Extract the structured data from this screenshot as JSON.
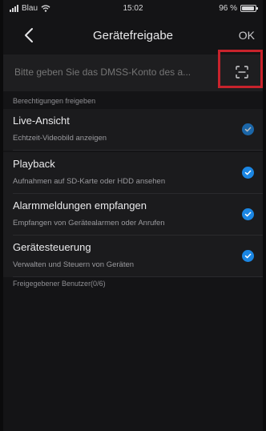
{
  "status_bar": {
    "carrier": "Blau",
    "time": "15:02",
    "battery": "96 %",
    "battery_level": 0.96
  },
  "nav": {
    "title": "Gerätefreigabe",
    "ok_label": "OK"
  },
  "account": {
    "placeholder": "Bitte geben Sie das DMSS-Konto des a..."
  },
  "sections": {
    "permissions": "Berechtigungen freigeben",
    "shared_users": "Freigegebener Benutzer(0/6)"
  },
  "permissions": [
    {
      "label": "Live-Ansicht",
      "description": "Echtzeit-Videobild anzeigen",
      "checked": true
    },
    {
      "label": "Playback",
      "description": "Aufnahmen auf SD-Karte oder HDD ansehen",
      "checked": true
    },
    {
      "label": "Alarmmeldungen empfangen",
      "description": "Empfangen von Gerätealarmen oder Anrufen",
      "checked": true
    },
    {
      "label": "Gerätesteuerung",
      "description": "Verwalten und Steuern von Geräten",
      "checked": true
    }
  ],
  "colors": {
    "accent": "#1b86e3",
    "highlight": "#c8232c",
    "background": "#141416"
  }
}
